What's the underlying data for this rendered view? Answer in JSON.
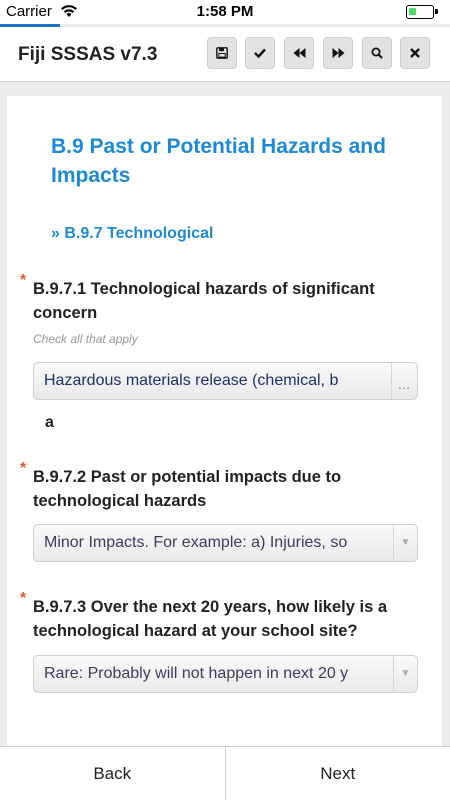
{
  "status_bar": {
    "carrier": "Carrier",
    "time": "1:58 PM"
  },
  "header": {
    "title": "Fiji SSSAS v7.3",
    "toolbar": [
      {
        "name": "save-button",
        "icon": "save-icon"
      },
      {
        "name": "check-button",
        "icon": "check-icon"
      },
      {
        "name": "rewind-button",
        "icon": "rewind-icon"
      },
      {
        "name": "fast-forward-button",
        "icon": "fast-forward-icon"
      },
      {
        "name": "search-button",
        "icon": "search-icon"
      },
      {
        "name": "close-button",
        "icon": "close-icon"
      }
    ]
  },
  "section": {
    "title": "B.9 Past or Potential Hazards and Impacts",
    "subsection": "» B.9.7 Technological"
  },
  "questions": [
    {
      "required_mark": "*",
      "text": "B.9.7.1 Technological hazards of significant concern",
      "hint": "Check all that apply",
      "value": "Hazardous materials release (chemical, b",
      "extra_value": "a",
      "control": "multi-select"
    },
    {
      "required_mark": "*",
      "text": "B.9.7.2 Past or potential impacts due to technological hazards",
      "value": "Minor Impacts. For example: a) Injuries, so",
      "control": "select"
    },
    {
      "required_mark": "*",
      "text": "B.9.7.3 Over the next 20 years, how likely is a technological hazard at your school site?",
      "value": "Rare: Probably will not happen in next 20 y",
      "control": "select"
    }
  ],
  "footer": {
    "back_label": "Back",
    "next_label": "Next"
  },
  "colors": {
    "accent": "#1d8ad5",
    "required": "#e35b2e",
    "progress": "#1a73c9",
    "battery": "#4cd964"
  }
}
